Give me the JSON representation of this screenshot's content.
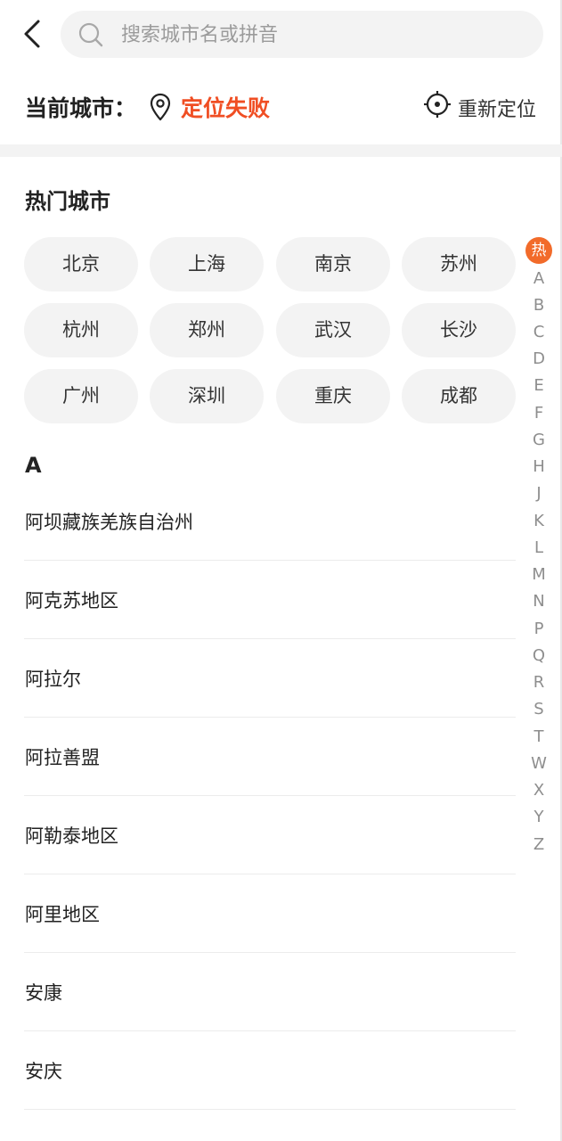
{
  "search": {
    "placeholder": "搜索城市名或拼音",
    "value": ""
  },
  "current": {
    "label": "当前城市：",
    "status": "定位失败",
    "relocate": "重新定位"
  },
  "hot": {
    "title": "热门城市",
    "cities": [
      "北京",
      "上海",
      "南京",
      "苏州",
      "杭州",
      "郑州",
      "武汉",
      "长沙",
      "广州",
      "深圳",
      "重庆",
      "成都"
    ]
  },
  "section": {
    "letter": "A"
  },
  "cities_a": [
    "阿坝藏族羌族自治州",
    "阿克苏地区",
    "阿拉尔",
    "阿拉善盟",
    "阿勒泰地区",
    "阿里地区",
    "安康",
    "安庆"
  ],
  "alphabet": {
    "hot": "热",
    "letters": [
      "A",
      "B",
      "C",
      "D",
      "E",
      "F",
      "G",
      "H",
      "J",
      "K",
      "L",
      "M",
      "N",
      "P",
      "Q",
      "R",
      "S",
      "T",
      "W",
      "X",
      "Y",
      "Z"
    ]
  },
  "colors": {
    "accent": "#f26b2a",
    "status": "#f04e23"
  }
}
